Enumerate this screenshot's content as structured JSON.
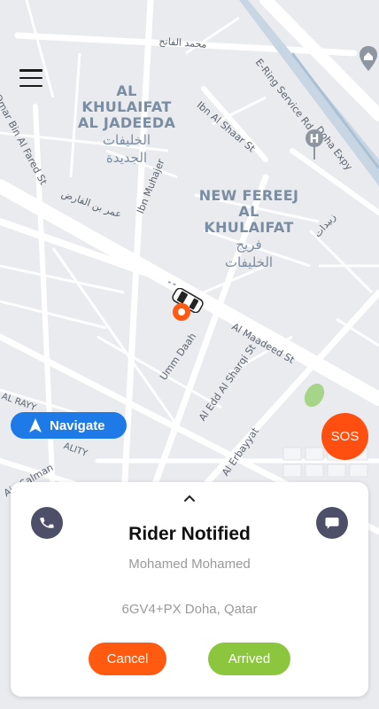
{
  "map": {
    "areas": [
      {
        "en1": "AL KHULAIFAT",
        "en2": "AL JADEEDA",
        "ar1": "الخليفات",
        "ar2": "الجديدة"
      },
      {
        "en1": "NEW FEREEJ",
        "en2": "AL KHULAIFAT",
        "ar1": "فريج",
        "ar2": "الخليفات"
      }
    ],
    "streets": {
      "mohammed_al_fatih": "محمد الفاتح",
      "ring_road": "E-Ring Service Rd",
      "omar_bin_al_fared": "Omar Bin Al Fared St",
      "ibn_al_shaar": "Ibn Al Shaar St",
      "doha_expy": "Doha Expy",
      "omar_bin_al_fared_ar": "عمر بن الفارض",
      "ibn_muhajer": "Ibn Muhajer",
      "zubaidat_ar": "زبيدات",
      "al_maadeed": "Al Maadeed St",
      "umm_daah": "Umm Daah",
      "al_edd_al_sharqi": "Al Edd Al Sharqi St",
      "al_erbayyat": "Al Erbayyat",
      "al_rayy": "AL RAYY",
      "ality": "ALITY",
      "ain_salman": "Ain Salman"
    },
    "poi_hospital_letter": "H"
  },
  "navigate": {
    "label": "Navigate"
  },
  "sos": {
    "label": "SOS"
  },
  "sheet": {
    "title": "Rider Notified",
    "rider_name": "Mohamed Mohamed",
    "address": "6GV4+PX Doha, Qatar",
    "cancel_label": "Cancel",
    "arrived_label": "Arrived"
  },
  "colors": {
    "accent_orange": "#ff5a10",
    "arrived_green": "#8cc63f",
    "navigate_blue": "#1e7ae6",
    "icon_circle": "#4d4f69"
  },
  "icons": [
    "menu-icon",
    "navigation-arrow-icon",
    "car-icon",
    "location-pin-icon",
    "chevron-up-icon",
    "phone-icon",
    "chat-icon",
    "hospital-icon",
    "place-marker-icon"
  ]
}
